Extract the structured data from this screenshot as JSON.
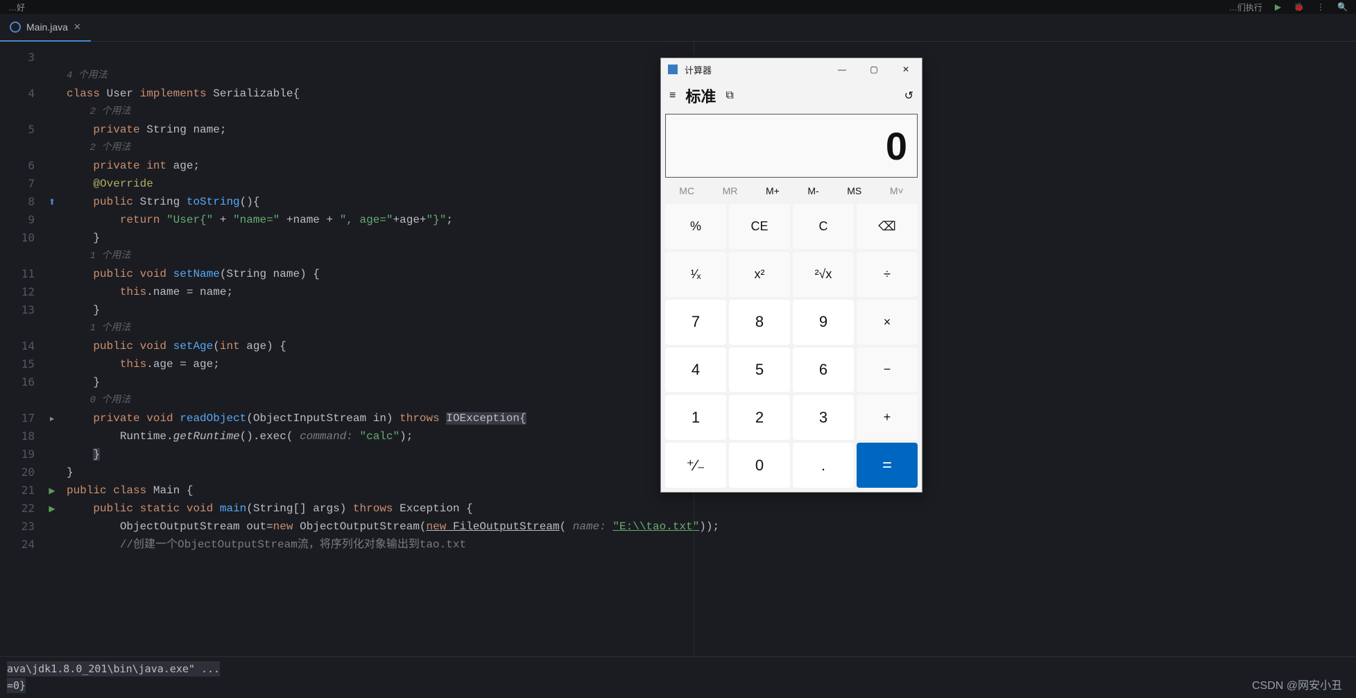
{
  "top_menu": {
    "left_label": "…好",
    "right_label": "…们执行"
  },
  "tab": {
    "filename": "Main.java"
  },
  "watermark": "CSDN @网安小丑",
  "console": {
    "line1": "ava\\jdk1.8.0_201\\bin\\java.exe\" ...",
    "line2": "=0}"
  },
  "lines": [
    {
      "num": 3,
      "content": ""
    },
    {
      "num": null,
      "content": "HINT:4 个用法"
    },
    {
      "num": 4,
      "content": "CLASS_DECL"
    },
    {
      "num": null,
      "content": "HINT:    2 个用法"
    },
    {
      "num": 5,
      "content": "FIELD_NAME"
    },
    {
      "num": null,
      "content": "HINT:    2 个用法"
    },
    {
      "num": 6,
      "content": "FIELD_AGE"
    },
    {
      "num": 7,
      "content": "OVERRIDE"
    },
    {
      "num": 8,
      "content": "TOSTRING"
    },
    {
      "num": 9,
      "content": "RETURN"
    },
    {
      "num": 10,
      "content": "CLOSE1"
    },
    {
      "num": null,
      "content": "HINT:    1 个用法"
    },
    {
      "num": 11,
      "content": "SETNAME"
    },
    {
      "num": 12,
      "content": "THIS_NAME"
    },
    {
      "num": 13,
      "content": "CLOSE1"
    },
    {
      "num": null,
      "content": "HINT:    1 个用法"
    },
    {
      "num": 14,
      "content": "SETAGE"
    },
    {
      "num": 15,
      "content": "THIS_AGE"
    },
    {
      "num": 16,
      "content": "CLOSE1"
    },
    {
      "num": null,
      "content": "HINT:    0 个用法"
    },
    {
      "num": 17,
      "content": "READOBJ"
    },
    {
      "num": 18,
      "content": "RUNTIME"
    },
    {
      "num": 19,
      "content": "CLOSE2"
    },
    {
      "num": 20,
      "content": "CLOSE3"
    },
    {
      "num": 21,
      "content": "MAINCLASS"
    },
    {
      "num": 22,
      "content": "MAINMETHOD"
    },
    {
      "num": 23,
      "content": "OOS"
    },
    {
      "num": 24,
      "content": "COMMENT"
    }
  ],
  "code_text": {
    "usage4": "4 个用法",
    "usage2": "2 个用法",
    "usage1": "1 个用法",
    "usage0": "0 个用法",
    "class_kw": "class",
    "user": "User",
    "implements": "implements",
    "serializable": "Serializable",
    "private": "private",
    "string_t": "String",
    "name_f": "name",
    "int_t": "int",
    "age_f": "age",
    "override": "@Override",
    "public": "public",
    "void": "void",
    "tostring": "toString",
    "return": "return",
    "concat1": "\"User{\"",
    "plus": "+",
    "concat2": "\"name=\"",
    "concat3": "\", age=\"",
    "concat4": "\"}\"",
    "setname": "setName",
    "setage": "setAge",
    "this": "this",
    "readobject": "readObject",
    "ois": "ObjectInputStream",
    "in": "in",
    "throws": "throws",
    "ioex": "IOException",
    "runtime": "Runtime",
    "getruntime": "getRuntime",
    "exec": "exec",
    "command_hint": "command:",
    "calc_str": "\"calc\"",
    "main_cls": "Main",
    "static": "static",
    "main_m": "main",
    "string_arr": "String[] args",
    "exception": "Exception",
    "oos_t": "ObjectOutputStream",
    "out": "out",
    "new": "new",
    "oos2": "ObjectOutputStream",
    "fos": "FileOutputStream",
    "name_hint": "name:",
    "path": "\"E:\\\\tao.txt\"",
    "comment": "//创建一个ObjectOutputStream流，将序列化对象输出到tao.txt"
  },
  "calc": {
    "title": "计算器",
    "mode": "标准",
    "display": "0",
    "mem": [
      "MC",
      "MR",
      "M+",
      "M-",
      "MS",
      "M˅"
    ],
    "grid": [
      {
        "label": "%",
        "cls": ""
      },
      {
        "label": "CE",
        "cls": ""
      },
      {
        "label": "C",
        "cls": ""
      },
      {
        "label": "⌫",
        "cls": ""
      },
      {
        "label": "¹⁄ₓ",
        "cls": ""
      },
      {
        "label": "x²",
        "cls": ""
      },
      {
        "label": "²√x",
        "cls": ""
      },
      {
        "label": "÷",
        "cls": ""
      },
      {
        "label": "7",
        "cls": "num"
      },
      {
        "label": "8",
        "cls": "num"
      },
      {
        "label": "9",
        "cls": "num"
      },
      {
        "label": "×",
        "cls": ""
      },
      {
        "label": "4",
        "cls": "num"
      },
      {
        "label": "5",
        "cls": "num"
      },
      {
        "label": "6",
        "cls": "num"
      },
      {
        "label": "−",
        "cls": ""
      },
      {
        "label": "1",
        "cls": "num"
      },
      {
        "label": "2",
        "cls": "num"
      },
      {
        "label": "3",
        "cls": "num"
      },
      {
        "label": "+",
        "cls": ""
      },
      {
        "label": "⁺∕₋",
        "cls": "num"
      },
      {
        "label": "0",
        "cls": "num"
      },
      {
        "label": ".",
        "cls": "num"
      },
      {
        "label": "=",
        "cls": "eq"
      }
    ]
  }
}
